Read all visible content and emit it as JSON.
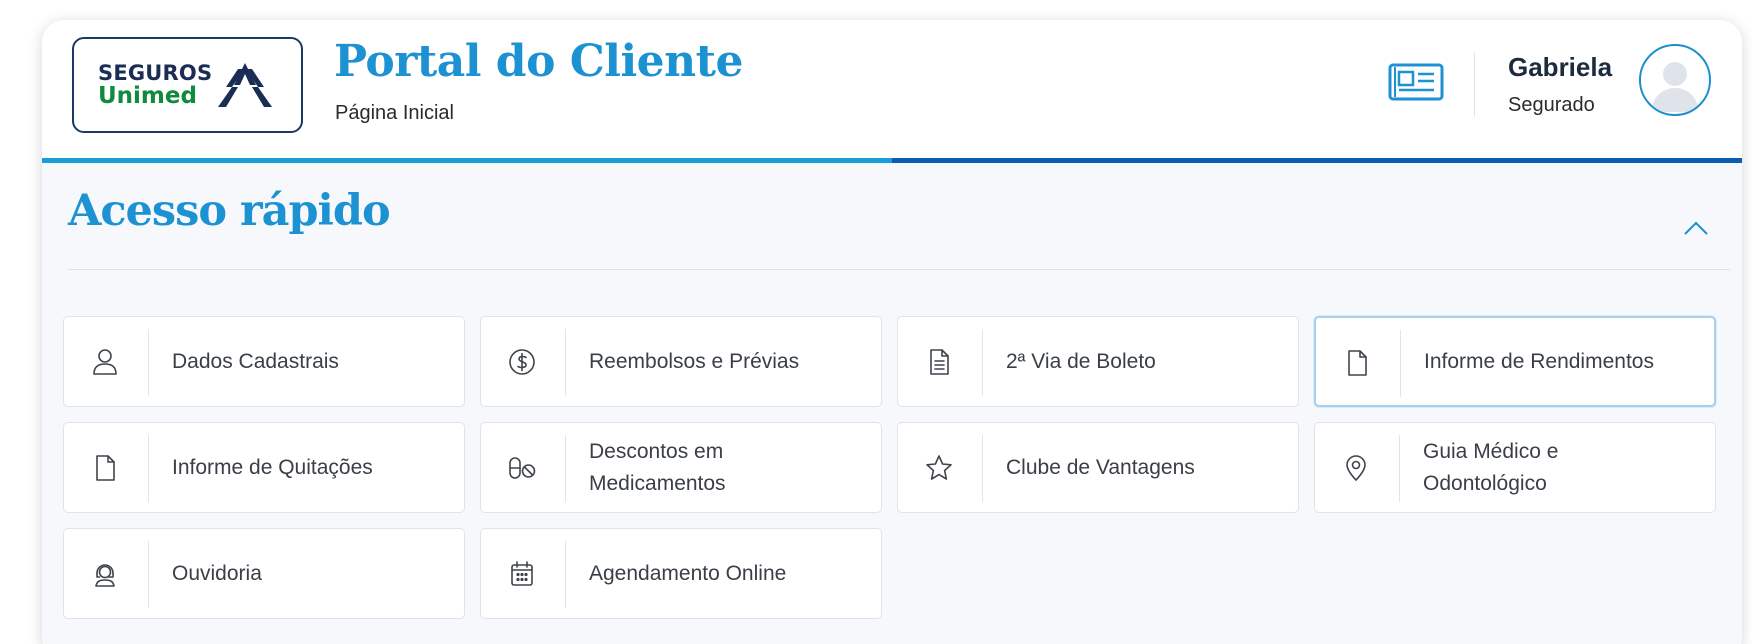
{
  "header": {
    "logo": {
      "line1": "SEGUROS",
      "line2": "Unimed"
    },
    "title": "Portal do Cliente",
    "subtitle": "Página Inicial",
    "news_icon": "newspaper-icon",
    "user": {
      "name": "Gabriela",
      "role": "Segurado",
      "avatar_icon": "user-avatar-icon"
    }
  },
  "progress": {
    "fraction": 0.5,
    "fill_color": "#1a9ed8",
    "track_color": "#0b5ead"
  },
  "section": {
    "title": "Acesso rápido",
    "collapse_icon": "chevron-up-icon",
    "cards": [
      {
        "label": "Dados Cadastrais",
        "icon": "user-icon"
      },
      {
        "label": "Reembolsos e Prévias",
        "icon": "dollar-circle-icon"
      },
      {
        "label": "2ª Via de Boleto",
        "icon": "document-lines-icon"
      },
      {
        "label": "Informe de Rendimentos",
        "icon": "file-icon",
        "selected": true
      },
      {
        "label": "Informe de Quitações",
        "icon": "file-icon"
      },
      {
        "label": "Descontos em Medicamentos",
        "icon": "pills-icon"
      },
      {
        "label": "Clube de Vantagens",
        "icon": "star-icon"
      },
      {
        "label": "Guia Médico e Odontológico",
        "icon": "location-pin-icon"
      },
      {
        "label": "Ouvidoria",
        "icon": "headset-icon"
      },
      {
        "label": "Agendamento Online",
        "icon": "calendar-icon"
      }
    ]
  },
  "colors": {
    "accent": "#1d92d3",
    "dark_blue": "#0b5ead",
    "brand_green": "#0f8b3e",
    "brand_navy": "#1c2d55"
  }
}
